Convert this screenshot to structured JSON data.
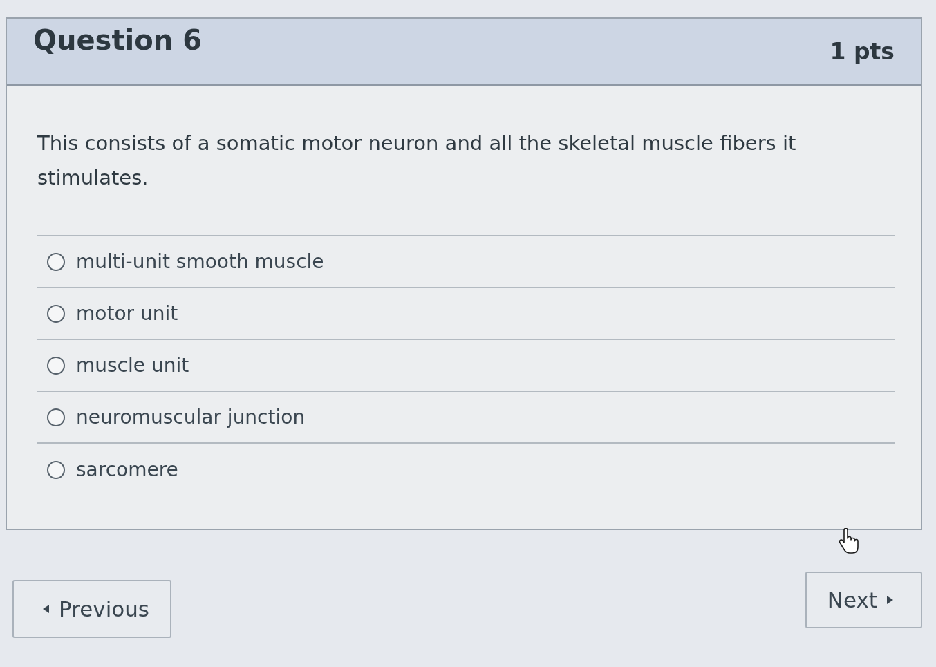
{
  "question": {
    "title": "Question 6",
    "points": "1 pts",
    "text": "This consists of a somatic motor neuron and all the skeletal muscle fibers it stimulates.",
    "answers": [
      {
        "label": "multi-unit smooth muscle",
        "selected": false
      },
      {
        "label": "motor unit",
        "selected": false
      },
      {
        "label": "muscle unit",
        "selected": false
      },
      {
        "label": "neuromuscular junction",
        "selected": false
      },
      {
        "label": "sarcomere",
        "selected": false
      }
    ]
  },
  "navigation": {
    "previous": "Previous",
    "next": "Next"
  }
}
